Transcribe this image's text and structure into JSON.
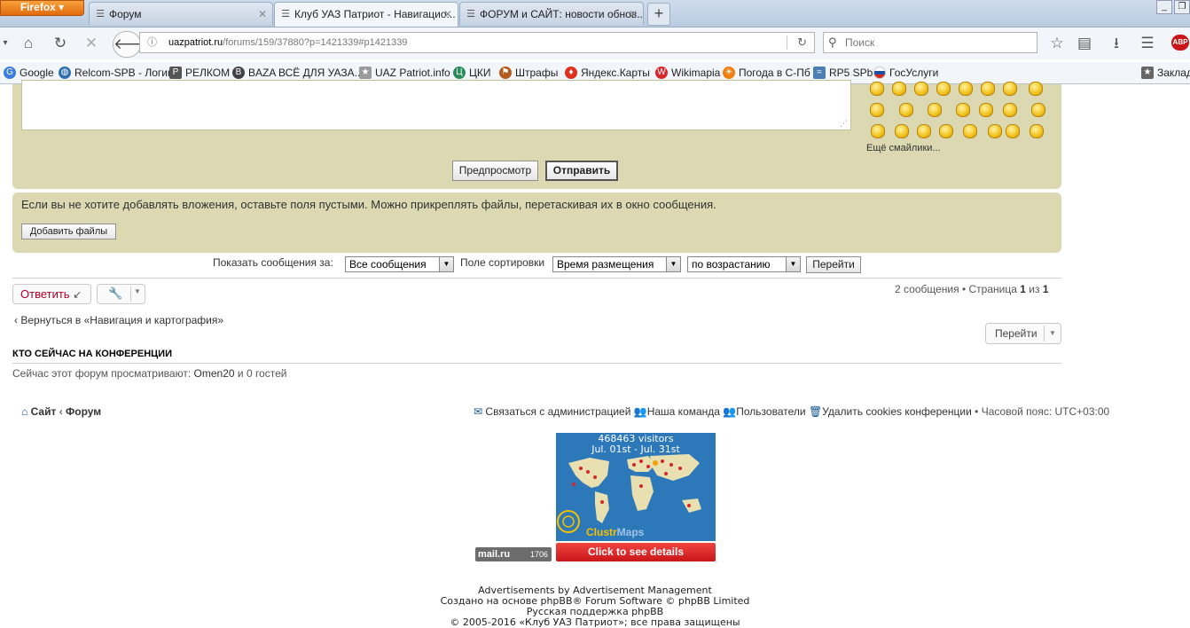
{
  "browser": {
    "app_button": "Firefox",
    "tabs": [
      {
        "label": "Форум",
        "active": false
      },
      {
        "label": "Клуб УАЗ Патриот - Навигацио...",
        "active": true
      },
      {
        "label": "ФОРУМ и САЙТ: новости обнов...",
        "active": false
      }
    ],
    "url_host": "uazpatriot.ru",
    "url_path": "/forums/159/37880?p=1421339#p1421339",
    "search_placeholder": "Поиск",
    "bookmarks": [
      {
        "label": "Google",
        "icon": "google-icon",
        "color": "#3b7ddd"
      },
      {
        "label": "Relcom-SPB - Логин",
        "icon": "globe-icon",
        "color": "#2f6fb2"
      },
      {
        "label": "РЕЛКОМ",
        "icon": "relcom-icon",
        "color": "#555555"
      },
      {
        "label": "BAZA ВСЁ ДЛЯ УАЗА...",
        "icon": "baza-icon",
        "color": "#444444"
      },
      {
        "label": "UAZ Patriot.info",
        "icon": "uaz-icon",
        "color": "#9a9a9a"
      },
      {
        "label": "ЦКИ",
        "icon": "cki-icon",
        "color": "#2a8a5a"
      },
      {
        "label": "Штрафы",
        "icon": "fines-icon",
        "color": "#b55a1c"
      },
      {
        "label": "Яндекс.Карты",
        "icon": "map-pin-icon",
        "color": "#e0301e"
      },
      {
        "label": "Wikimapia",
        "icon": "wikimapia-icon",
        "color": "#d9272e"
      },
      {
        "label": "Погода в С-Пб",
        "icon": "weather-icon",
        "color": "#f07f10"
      },
      {
        "label": "RP5 SPb",
        "icon": "rp5-icon",
        "color": "#4a7fb5"
      },
      {
        "label": "ГосУслуги",
        "icon": "gosuslugi-icon",
        "color": "#1f4fa0"
      },
      {
        "label": "Заклад",
        "icon": "bookmarks-folder-icon",
        "color": "#666666"
      }
    ]
  },
  "editor": {
    "more_smileys": "Ещё смайлики...",
    "preview_button": "Предпросмотр",
    "submit_button": "Отправить"
  },
  "attachments": {
    "message": "Если вы не хотите добавлять вложения, оставьте поля пустыми. Можно прикреплять файлы, перетаскивая их в окно сообщения.",
    "add_files_button": "Добавить файлы"
  },
  "sort": {
    "show_label": "Показать сообщения за:",
    "show_value": "Все сообщения",
    "sort_label": "Поле сортировки",
    "sort_value": "Время размещения",
    "order_value": "по возрастанию",
    "go_button": "Перейти"
  },
  "topic_actions": {
    "reply_button": "Ответить",
    "pagination_count": "2 сообщения",
    "pagination_page_label": "Страница",
    "pagination_page": "1",
    "pagination_of": "из",
    "pagination_total": "1"
  },
  "back_link": "Вернуться в «Навигация и картография»",
  "jump_button": "Перейти",
  "online": {
    "heading": "КТО СЕЙЧАС НА КОНФЕРЕНЦИИ",
    "prefix": "Сейчас этот форум просматривают:",
    "user": "Omen20",
    "and": "и",
    "guests": "0 гостей"
  },
  "footer": {
    "site": "Сайт",
    "forum": "Форум",
    "contact": "Связаться с администрацией",
    "team": "Наша команда",
    "members": "Пользователи",
    "delete_cookies": "Удалить cookies конференции",
    "timezone": "Часовой пояс: UTC+03:00"
  },
  "clustrmaps": {
    "visitors": "468463 visitors",
    "period": "Jul. 01st - Jul. 31st",
    "brand_a": "Clustr",
    "brand_b": "Maps",
    "button": "Click to see details"
  },
  "mailru": {
    "label": "mail.ru",
    "count": "1706"
  },
  "credits": {
    "line1": "Advertisements by Advertisement Management",
    "line2": "Создано на основе phpBB® Forum Software © phpBB Limited",
    "line3": "Русская поддержка phpBB",
    "line4": "© 2005-2016 «Клуб УАЗ Патриот»; все права защищены"
  }
}
